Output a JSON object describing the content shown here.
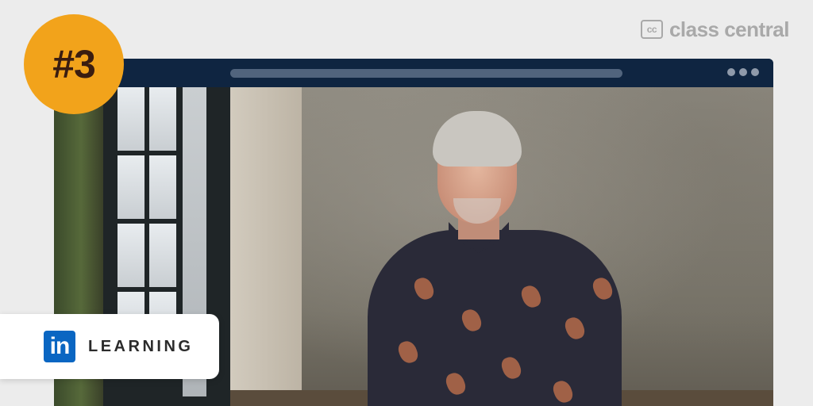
{
  "brand": {
    "mark": "cc",
    "name": "class central"
  },
  "badge": {
    "text": "#3"
  },
  "provider": {
    "logo_text": "in",
    "name": "LEARNING"
  },
  "colors": {
    "background": "#ececec",
    "badge": "#f2a31b",
    "browser_bar": "#0f2541",
    "linkedin_blue": "#0a66c2"
  },
  "icons": [
    "class-central-logo-icon",
    "linkedin-learning-logo-icon",
    "more-options-icon"
  ]
}
